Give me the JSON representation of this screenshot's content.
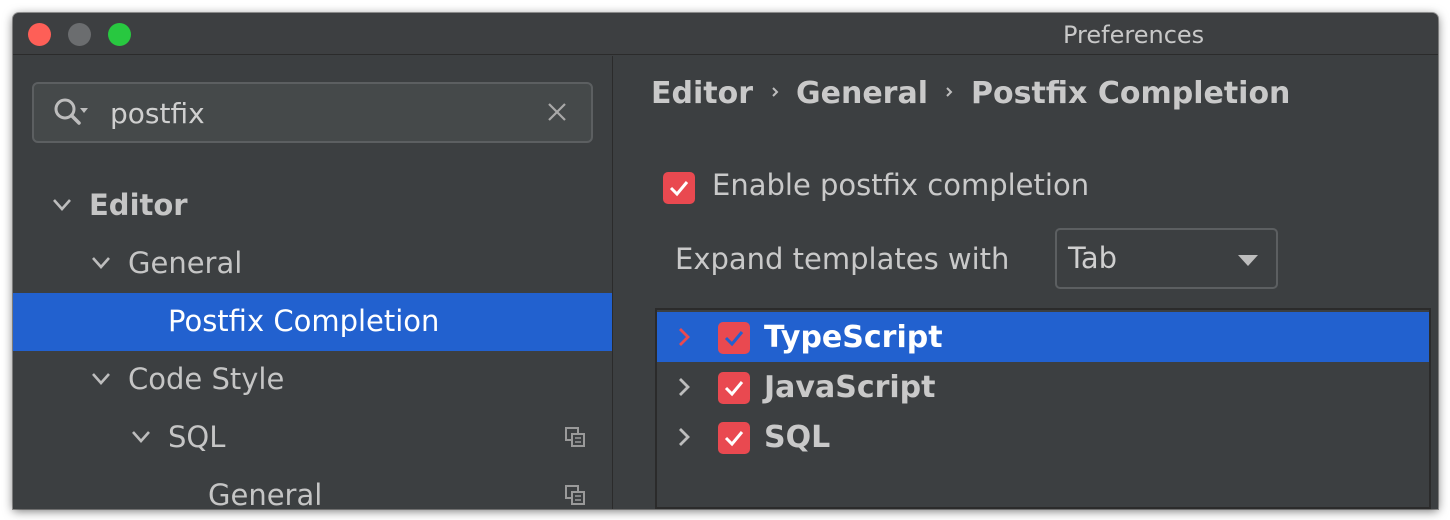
{
  "window": {
    "title": "Preferences"
  },
  "search": {
    "value": "postfix",
    "icon": "search-icon",
    "clear_icon": "close-icon"
  },
  "sidebar": {
    "items": [
      {
        "label": "Editor",
        "expanded": true,
        "selected": false
      },
      {
        "label": "General",
        "expanded": true,
        "selected": false
      },
      {
        "label": "Postfix Completion",
        "selected": true
      },
      {
        "label": "Code Style",
        "expanded": true,
        "selected": false
      },
      {
        "label": "SQL",
        "expanded": true,
        "selected": false,
        "icon": "copy-icon"
      },
      {
        "label": "General",
        "selected": false,
        "icon": "copy-icon"
      }
    ]
  },
  "breadcrumb": [
    "Editor",
    "General",
    "Postfix Completion"
  ],
  "settings": {
    "enable_label": "Enable postfix completion",
    "enable_checked": true,
    "expand_label": "Expand templates with",
    "expand_value": "Tab"
  },
  "templates": [
    {
      "label": "TypeScript",
      "checked": true,
      "selected": true
    },
    {
      "label": "JavaScript",
      "checked": true,
      "selected": false
    },
    {
      "label": "SQL",
      "checked": true,
      "selected": false
    }
  ],
  "colors": {
    "accent": "#2261cf",
    "checkbox": "#e94950",
    "background": "#3c3f41"
  }
}
